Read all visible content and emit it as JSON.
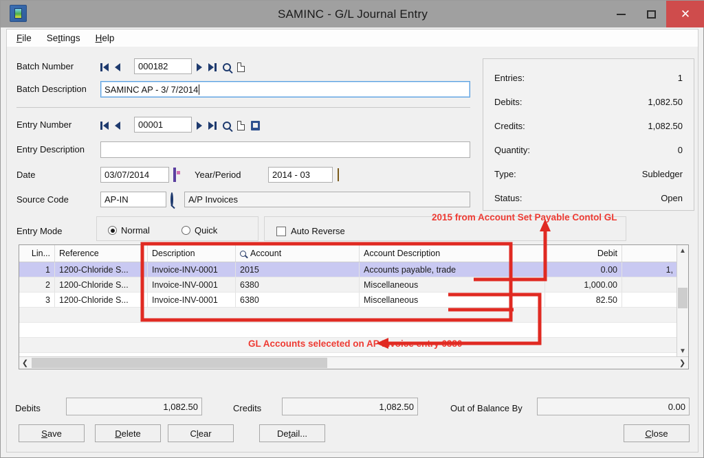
{
  "window": {
    "title": "SAMINC - G/L Journal Entry",
    "minimize_label": "–",
    "maximize_label": "□",
    "close_label": "✕",
    "app_icon": "sage-app-icon"
  },
  "menu": [
    {
      "label": "File",
      "accel": "F"
    },
    {
      "label": "Settings",
      "accel": "t"
    },
    {
      "label": "Help",
      "accel": "H"
    }
  ],
  "form": {
    "batch_number_label": "Batch Number",
    "batch_number_value": "000182",
    "batch_description_label": "Batch Description",
    "batch_description_value": "SAMINC AP -  3/ 7/2014",
    "entry_number_label": "Entry Number",
    "entry_number_value": "00001",
    "entry_description_label": "Entry Description",
    "entry_description_value": "",
    "date_label": "Date",
    "date_value": "03/07/2014",
    "year_period_label": "Year/Period",
    "year_period_value": "2014 - 03",
    "source_code_label": "Source Code",
    "source_code_value": "AP-IN",
    "source_code_description": "A/P Invoices",
    "entry_mode_label": "Entry Mode",
    "entry_mode_normal": "Normal",
    "entry_mode_quick": "Quick",
    "entry_mode_selected": "Normal",
    "auto_reverse_label": "Auto Reverse",
    "auto_reverse_checked": false
  },
  "info_panel": [
    {
      "key": "Entries:",
      "value": "1"
    },
    {
      "key": "Debits:",
      "value": "1,082.50"
    },
    {
      "key": "Credits:",
      "value": "1,082.50"
    },
    {
      "key": "Quantity:",
      "value": "0"
    },
    {
      "key": "Type:",
      "value": "Subledger"
    },
    {
      "key": "Status:",
      "value": "Open"
    }
  ],
  "grid": {
    "columns": [
      {
        "key": "line",
        "label": "Lin...",
        "align": "right"
      },
      {
        "key": "reference",
        "label": "Reference",
        "align": "left"
      },
      {
        "key": "description",
        "label": "Description",
        "align": "left"
      },
      {
        "key": "account",
        "label": "Account",
        "align": "left",
        "icon": "search-icon"
      },
      {
        "key": "account_description",
        "label": "Account Description",
        "align": "left"
      },
      {
        "key": "spacer",
        "label": "",
        "align": "left"
      },
      {
        "key": "debit",
        "label": "Debit",
        "align": "right"
      },
      {
        "key": "credit",
        "label": "",
        "align": "right"
      }
    ],
    "rows": [
      {
        "line": "1",
        "reference": "1200-Chloride S...",
        "description": "Invoice-INV-0001",
        "account": "2015",
        "account_description": "Accounts payable, trade",
        "spacer": "",
        "debit": "0.00",
        "credit": "1,",
        "selected": true
      },
      {
        "line": "2",
        "reference": "1200-Chloride S...",
        "description": "Invoice-INV-0001",
        "account": "6380",
        "account_description": "Miscellaneous",
        "spacer": "",
        "debit": "1,000.00",
        "credit": "",
        "selected": false
      },
      {
        "line": "3",
        "reference": "1200-Chloride S...",
        "description": "Invoice-INV-0001",
        "account": "6380",
        "account_description": "Miscellaneous",
        "spacer": "",
        "debit": "82.50",
        "credit": "",
        "selected": false
      }
    ],
    "empty_rows": 4,
    "scroll_up_icon": "chevron-up-icon",
    "scroll_down_icon": "chevron-down-icon",
    "scroll_left_icon": "chevron-left-icon",
    "scroll_right_icon": "chevron-right-icon"
  },
  "totals": {
    "debits_label": "Debits",
    "debits_value": "1,082.50",
    "credits_label": "Credits",
    "credits_value": "1,082.50",
    "out_of_balance_label": "Out of Balance By",
    "out_of_balance_value": "0.00"
  },
  "buttons": [
    {
      "name": "save-button",
      "label": "Save",
      "accel": "S"
    },
    {
      "name": "delete-button",
      "label": "Delete",
      "accel": "D"
    },
    {
      "name": "clear-button",
      "label": "Clear",
      "accel": "l"
    },
    {
      "name": "detail-button",
      "label": "Detail...",
      "accel": "t"
    },
    {
      "name": "close-button",
      "label": "Close",
      "accel": "C"
    }
  ],
  "annotations": {
    "top_note": "2015 from Account Set Payable Contol GL",
    "bottom_note": "GL Accounts seleceted on AP Invoice entry 6380",
    "color": "#ee3b33"
  }
}
